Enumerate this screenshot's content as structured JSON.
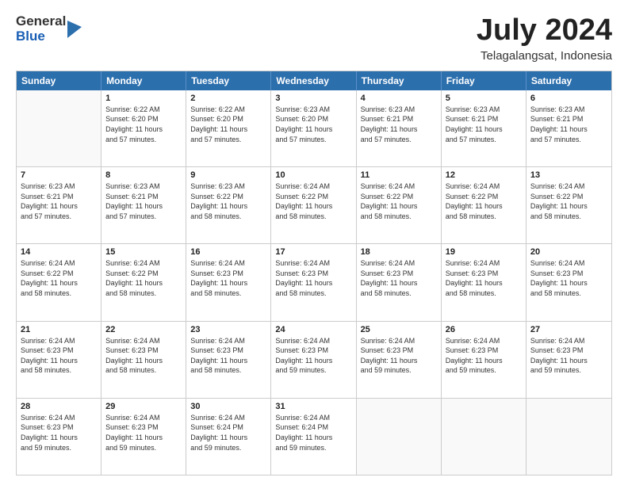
{
  "logo": {
    "general": "General",
    "blue": "Blue"
  },
  "header": {
    "month": "July 2024",
    "location": "Telagalangsat, Indonesia"
  },
  "days": [
    "Sunday",
    "Monday",
    "Tuesday",
    "Wednesday",
    "Thursday",
    "Friday",
    "Saturday"
  ],
  "weeks": [
    [
      {
        "day": "",
        "info": ""
      },
      {
        "day": "1",
        "info": "Sunrise: 6:22 AM\nSunset: 6:20 PM\nDaylight: 11 hours\nand 57 minutes."
      },
      {
        "day": "2",
        "info": "Sunrise: 6:22 AM\nSunset: 6:20 PM\nDaylight: 11 hours\nand 57 minutes."
      },
      {
        "day": "3",
        "info": "Sunrise: 6:23 AM\nSunset: 6:20 PM\nDaylight: 11 hours\nand 57 minutes."
      },
      {
        "day": "4",
        "info": "Sunrise: 6:23 AM\nSunset: 6:21 PM\nDaylight: 11 hours\nand 57 minutes."
      },
      {
        "day": "5",
        "info": "Sunrise: 6:23 AM\nSunset: 6:21 PM\nDaylight: 11 hours\nand 57 minutes."
      },
      {
        "day": "6",
        "info": "Sunrise: 6:23 AM\nSunset: 6:21 PM\nDaylight: 11 hours\nand 57 minutes."
      }
    ],
    [
      {
        "day": "7",
        "info": "Sunrise: 6:23 AM\nSunset: 6:21 PM\nDaylight: 11 hours\nand 57 minutes."
      },
      {
        "day": "8",
        "info": "Sunrise: 6:23 AM\nSunset: 6:21 PM\nDaylight: 11 hours\nand 57 minutes."
      },
      {
        "day": "9",
        "info": "Sunrise: 6:23 AM\nSunset: 6:22 PM\nDaylight: 11 hours\nand 58 minutes."
      },
      {
        "day": "10",
        "info": "Sunrise: 6:24 AM\nSunset: 6:22 PM\nDaylight: 11 hours\nand 58 minutes."
      },
      {
        "day": "11",
        "info": "Sunrise: 6:24 AM\nSunset: 6:22 PM\nDaylight: 11 hours\nand 58 minutes."
      },
      {
        "day": "12",
        "info": "Sunrise: 6:24 AM\nSunset: 6:22 PM\nDaylight: 11 hours\nand 58 minutes."
      },
      {
        "day": "13",
        "info": "Sunrise: 6:24 AM\nSunset: 6:22 PM\nDaylight: 11 hours\nand 58 minutes."
      }
    ],
    [
      {
        "day": "14",
        "info": "Sunrise: 6:24 AM\nSunset: 6:22 PM\nDaylight: 11 hours\nand 58 minutes."
      },
      {
        "day": "15",
        "info": "Sunrise: 6:24 AM\nSunset: 6:22 PM\nDaylight: 11 hours\nand 58 minutes."
      },
      {
        "day": "16",
        "info": "Sunrise: 6:24 AM\nSunset: 6:23 PM\nDaylight: 11 hours\nand 58 minutes."
      },
      {
        "day": "17",
        "info": "Sunrise: 6:24 AM\nSunset: 6:23 PM\nDaylight: 11 hours\nand 58 minutes."
      },
      {
        "day": "18",
        "info": "Sunrise: 6:24 AM\nSunset: 6:23 PM\nDaylight: 11 hours\nand 58 minutes."
      },
      {
        "day": "19",
        "info": "Sunrise: 6:24 AM\nSunset: 6:23 PM\nDaylight: 11 hours\nand 58 minutes."
      },
      {
        "day": "20",
        "info": "Sunrise: 6:24 AM\nSunset: 6:23 PM\nDaylight: 11 hours\nand 58 minutes."
      }
    ],
    [
      {
        "day": "21",
        "info": "Sunrise: 6:24 AM\nSunset: 6:23 PM\nDaylight: 11 hours\nand 58 minutes."
      },
      {
        "day": "22",
        "info": "Sunrise: 6:24 AM\nSunset: 6:23 PM\nDaylight: 11 hours\nand 58 minutes."
      },
      {
        "day": "23",
        "info": "Sunrise: 6:24 AM\nSunset: 6:23 PM\nDaylight: 11 hours\nand 58 minutes."
      },
      {
        "day": "24",
        "info": "Sunrise: 6:24 AM\nSunset: 6:23 PM\nDaylight: 11 hours\nand 59 minutes."
      },
      {
        "day": "25",
        "info": "Sunrise: 6:24 AM\nSunset: 6:23 PM\nDaylight: 11 hours\nand 59 minutes."
      },
      {
        "day": "26",
        "info": "Sunrise: 6:24 AM\nSunset: 6:23 PM\nDaylight: 11 hours\nand 59 minutes."
      },
      {
        "day": "27",
        "info": "Sunrise: 6:24 AM\nSunset: 6:23 PM\nDaylight: 11 hours\nand 59 minutes."
      }
    ],
    [
      {
        "day": "28",
        "info": "Sunrise: 6:24 AM\nSunset: 6:23 PM\nDaylight: 11 hours\nand 59 minutes."
      },
      {
        "day": "29",
        "info": "Sunrise: 6:24 AM\nSunset: 6:23 PM\nDaylight: 11 hours\nand 59 minutes."
      },
      {
        "day": "30",
        "info": "Sunrise: 6:24 AM\nSunset: 6:24 PM\nDaylight: 11 hours\nand 59 minutes."
      },
      {
        "day": "31",
        "info": "Sunrise: 6:24 AM\nSunset: 6:24 PM\nDaylight: 11 hours\nand 59 minutes."
      },
      {
        "day": "",
        "info": ""
      },
      {
        "day": "",
        "info": ""
      },
      {
        "day": "",
        "info": ""
      }
    ]
  ]
}
